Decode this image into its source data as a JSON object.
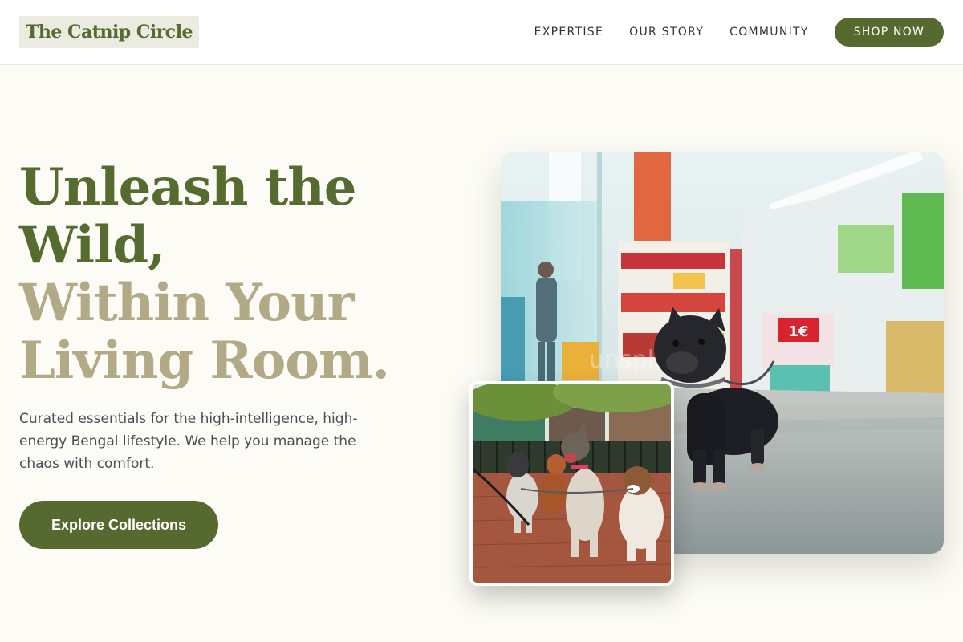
{
  "header": {
    "logo_text": "The Catnip Circle",
    "nav": [
      {
        "label": "EXPERTISE"
      },
      {
        "label": "OUR STORY"
      },
      {
        "label": "COMMUNITY"
      }
    ],
    "shop_button": "SHOP NOW"
  },
  "hero": {
    "headline_line1": "Unleash the",
    "headline_line2": "Wild,",
    "headline_line3": "Within Your",
    "headline_line4": "Living Room.",
    "subtext": "Curated essentials for the high-intelligence, high-energy Bengal lifestyle. We help you manage the chaos with comfort.",
    "cta_label": "Explore Collections"
  },
  "images": {
    "main_sign_text": "1€",
    "main_watermark": "unsplash"
  },
  "colors": {
    "brand_green": "#566a30",
    "headline_dark": "#556b2f",
    "headline_light": "#b2a986",
    "background": "#fcfbf5"
  }
}
